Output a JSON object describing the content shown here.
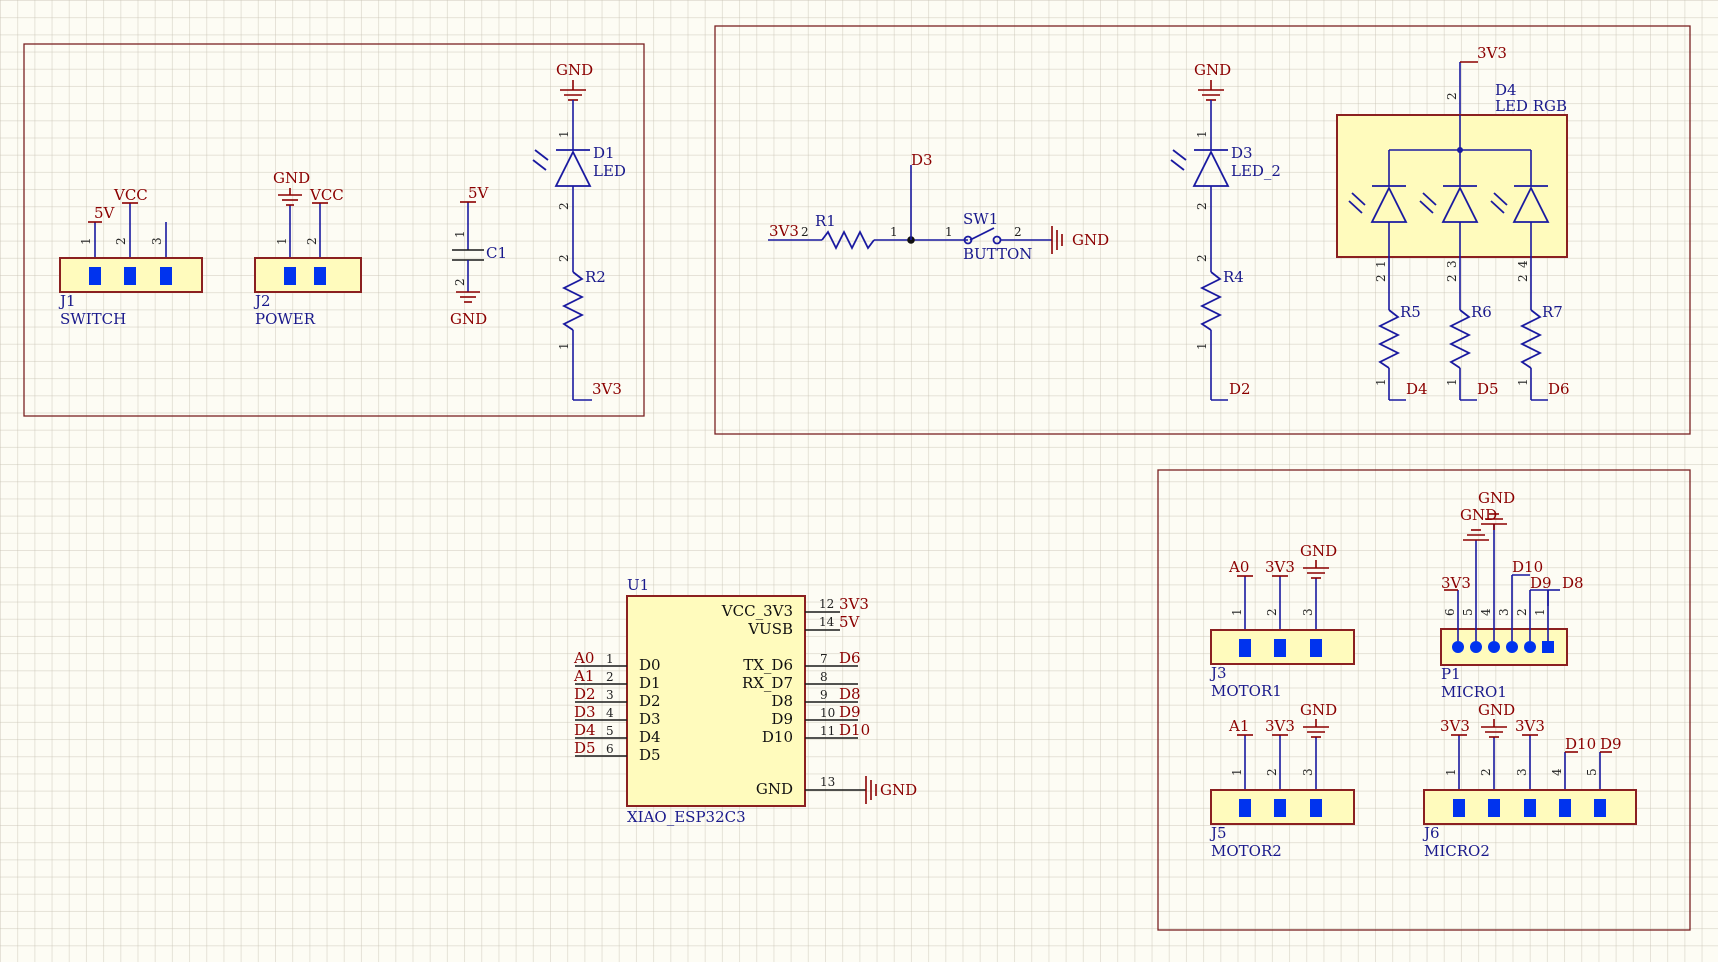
{
  "nets": {
    "gnd": "GND",
    "vcc": "VCC",
    "v5": "5V",
    "v3v3": "3V3",
    "d0": "D0",
    "d1": "D1",
    "d2": "D2",
    "d3": "D3",
    "d4": "D4",
    "d5": "D5",
    "d6": "D6",
    "d8": "D8",
    "d9": "D9",
    "d10": "D10",
    "a0": "A0",
    "a1": "A1"
  },
  "components": {
    "j1": {
      "ref": "J1",
      "value": "SWITCH"
    },
    "j2": {
      "ref": "J2",
      "value": "POWER"
    },
    "c1": {
      "ref": "C1"
    },
    "d1": {
      "ref": "D1",
      "value": "LED"
    },
    "r2": {
      "ref": "R2"
    },
    "r1": {
      "ref": "R1"
    },
    "sw1": {
      "ref": "SW1",
      "value": "BUTTON"
    },
    "d3": {
      "ref": "D3",
      "value": "LED_2"
    },
    "r4": {
      "ref": "R4"
    },
    "d4": {
      "ref": "D4",
      "value": "LED RGB"
    },
    "r5": {
      "ref": "R5"
    },
    "r6": {
      "ref": "R6"
    },
    "r7": {
      "ref": "R7"
    },
    "u1": {
      "ref": "U1",
      "value": "XIAO_ESP32C3"
    },
    "j3": {
      "ref": "J3",
      "value": "MOTOR1"
    },
    "j5": {
      "ref": "J5",
      "value": "MOTOR2"
    },
    "p1": {
      "ref": "P1",
      "value": "MICRO1"
    },
    "j6": {
      "ref": "J6",
      "value": "MICRO2"
    }
  },
  "u1_pins": {
    "right_top": [
      "VCC_3V3",
      "VUSB"
    ],
    "right": [
      "TX_D6",
      "RX_D7",
      "D8",
      "D9",
      "D10"
    ],
    "left": [
      "D0",
      "D1",
      "D2",
      "D3",
      "D4",
      "D5"
    ],
    "gnd": "GND"
  },
  "pin_numbers": [
    "1",
    "2",
    "3",
    "4",
    "5",
    "6",
    "7",
    "8",
    "9",
    "10",
    "11",
    "12",
    "13",
    "14"
  ],
  "colors": {
    "wire": "#1a1aa0",
    "net": "#8b0000",
    "body": "#fffbbd",
    "pad": "#0033ee",
    "background": "#fdfcf4"
  }
}
